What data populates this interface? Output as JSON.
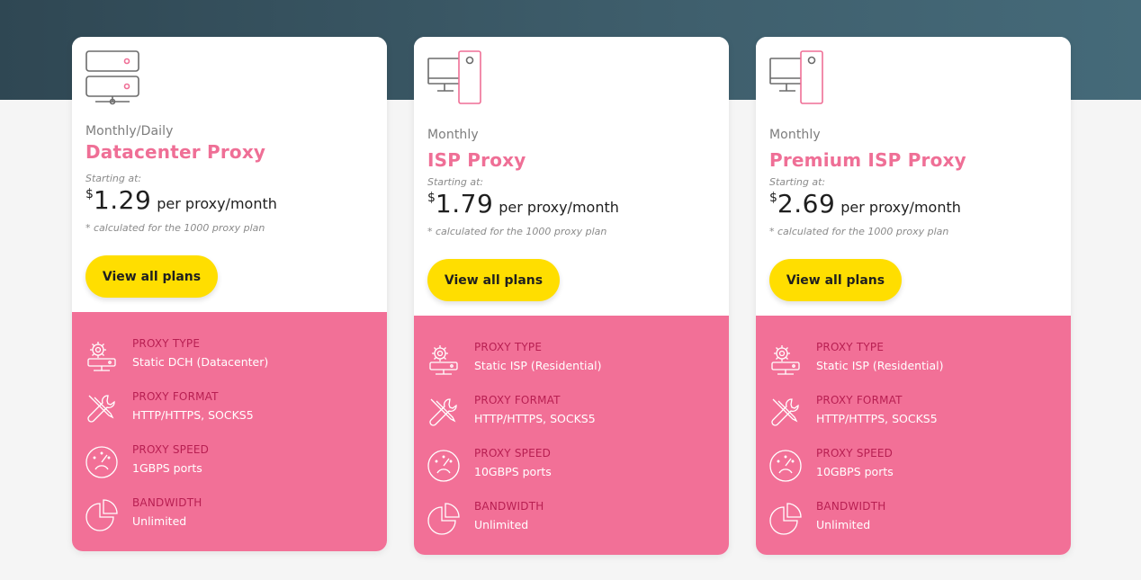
{
  "colors": {
    "header_band": "#3f5f6d",
    "accent_pink": "#ef6f96",
    "feature_bg": "#f27097",
    "feature_label": "#b81f52",
    "button_yellow": "#ffde00"
  },
  "cards": [
    {
      "icon": "server-rack-icon",
      "frequency": "Monthly/Daily",
      "title": "Datacenter Proxy",
      "starting_label": "Starting at:",
      "currency": "$",
      "price": "1.29",
      "per": "per proxy/month",
      "note": "* calculated for the 1000 proxy plan",
      "button_label": "View all plans",
      "features": [
        {
          "icon": "gear-network-icon",
          "label": "PROXY TYPE",
          "value": "Static DCH (Datacenter)"
        },
        {
          "icon": "tools-icon",
          "label": "PROXY FORMAT",
          "value": "HTTP/HTTPS, SOCKS5"
        },
        {
          "icon": "speedometer-icon",
          "label": "PROXY SPEED",
          "value": "1GBPS ports"
        },
        {
          "icon": "pie-chart-icon",
          "label": "BANDWIDTH",
          "value": "Unlimited"
        }
      ]
    },
    {
      "icon": "desktop-computer-icon",
      "frequency": "Monthly",
      "title": "ISP Proxy",
      "starting_label": "Starting at:",
      "currency": "$",
      "price": "1.79",
      "per": "per proxy/month",
      "note": "* calculated for the 1000 proxy plan",
      "button_label": "View all plans",
      "features": [
        {
          "icon": "gear-network-icon",
          "label": "PROXY TYPE",
          "value": "Static ISP (Residential)"
        },
        {
          "icon": "tools-icon",
          "label": "PROXY FORMAT",
          "value": "HTTP/HTTPS, SOCKS5"
        },
        {
          "icon": "speedometer-icon",
          "label": "PROXY SPEED",
          "value": "10GBPS ports"
        },
        {
          "icon": "pie-chart-icon",
          "label": "BANDWIDTH",
          "value": "Unlimited"
        }
      ]
    },
    {
      "icon": "desktop-computer-icon",
      "frequency": "Monthly",
      "title": "Premium ISP Proxy",
      "starting_label": "Starting at:",
      "currency": "$",
      "price": "2.69",
      "per": "per proxy/month",
      "note": "* calculated for the 1000 proxy plan",
      "button_label": "View all plans",
      "features": [
        {
          "icon": "gear-network-icon",
          "label": "PROXY TYPE",
          "value": "Static ISP (Residential)"
        },
        {
          "icon": "tools-icon",
          "label": "PROXY FORMAT",
          "value": "HTTP/HTTPS, SOCKS5"
        },
        {
          "icon": "speedometer-icon",
          "label": "PROXY SPEED",
          "value": "10GBPS ports"
        },
        {
          "icon": "pie-chart-icon",
          "label": "BANDWIDTH",
          "value": "Unlimited"
        }
      ]
    }
  ]
}
